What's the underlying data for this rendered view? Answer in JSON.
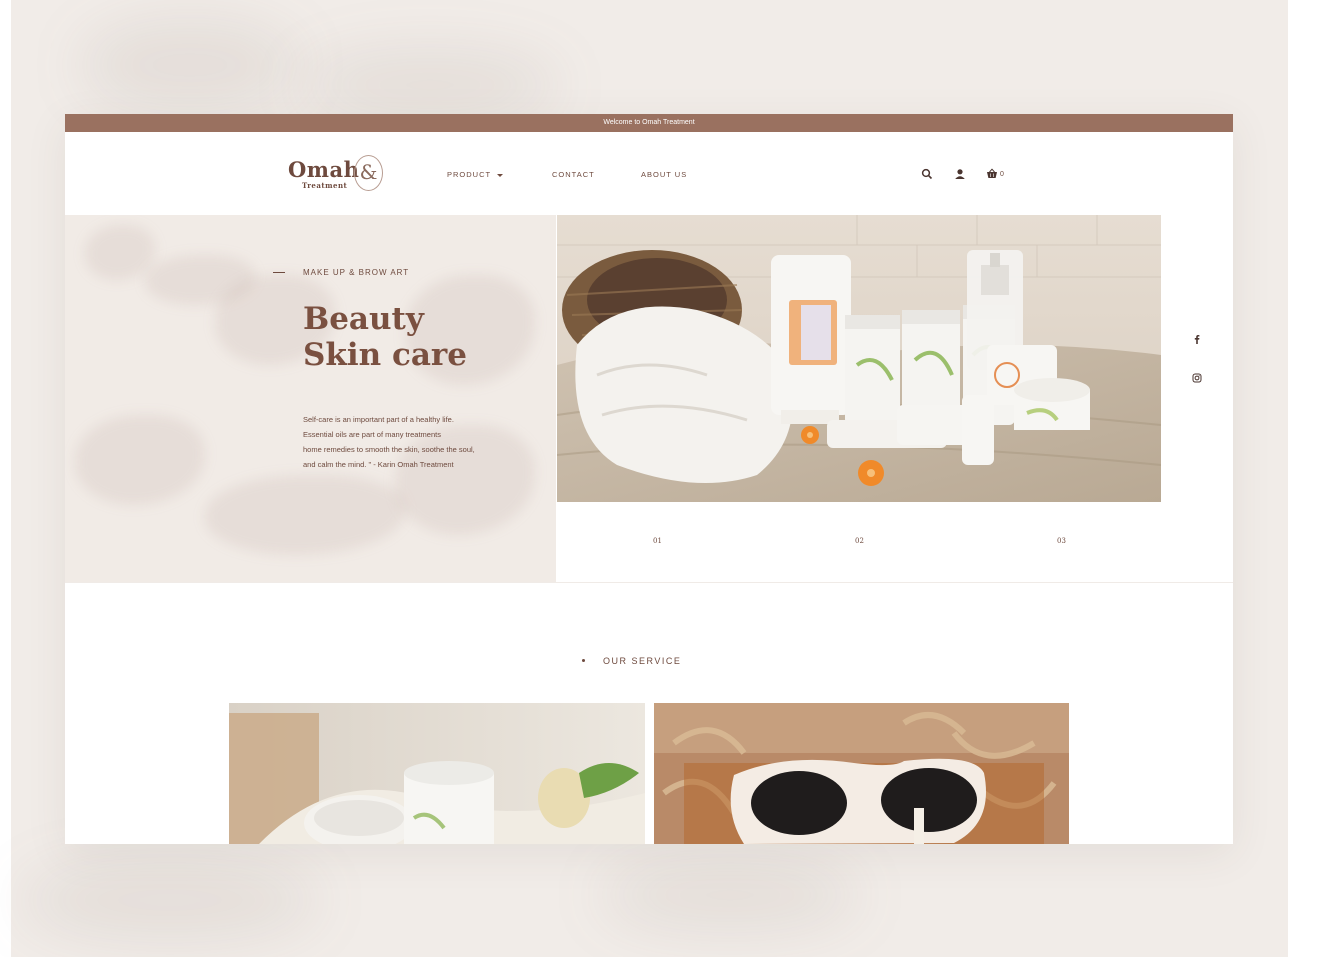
{
  "topbar": {
    "text": "Welcome to Omah Treatment"
  },
  "logo": {
    "name": "Omah",
    "sub": "Treatment",
    "mark": "&"
  },
  "nav": {
    "product": "PRODUCT",
    "contact": "CONTACT",
    "about": "ABOUT US"
  },
  "header_icons": {
    "search": "search-icon",
    "account": "user-icon",
    "cart": "cart-icon",
    "cart_count": "0"
  },
  "hero": {
    "eyebrow": "MAKE UP & BROW ART",
    "title_line1": "Beauty",
    "title_line2": "Skin care",
    "text_l1": "Self-care is an important part of a healthy life.",
    "text_l2": "Essential oils are part of many treatments",
    "text_l3": "home remedies to smooth the skin, soothe the soul,",
    "text_l4": "and calm the mind. \" - Karin Omah Treatment",
    "slides": [
      "01",
      "02",
      "03"
    ],
    "image": "skincare-products-photo"
  },
  "social": {
    "facebook": "facebook-icon",
    "instagram": "instagram-icon"
  },
  "service": {
    "title": "OUR SERVICE",
    "cards": [
      "cream-jar-photo",
      "sunglasses-box-photo"
    ]
  },
  "colors": {
    "accent": "#9a7160",
    "brand_text": "#6e4a3e",
    "hero_bg": "#f1ebe6"
  }
}
